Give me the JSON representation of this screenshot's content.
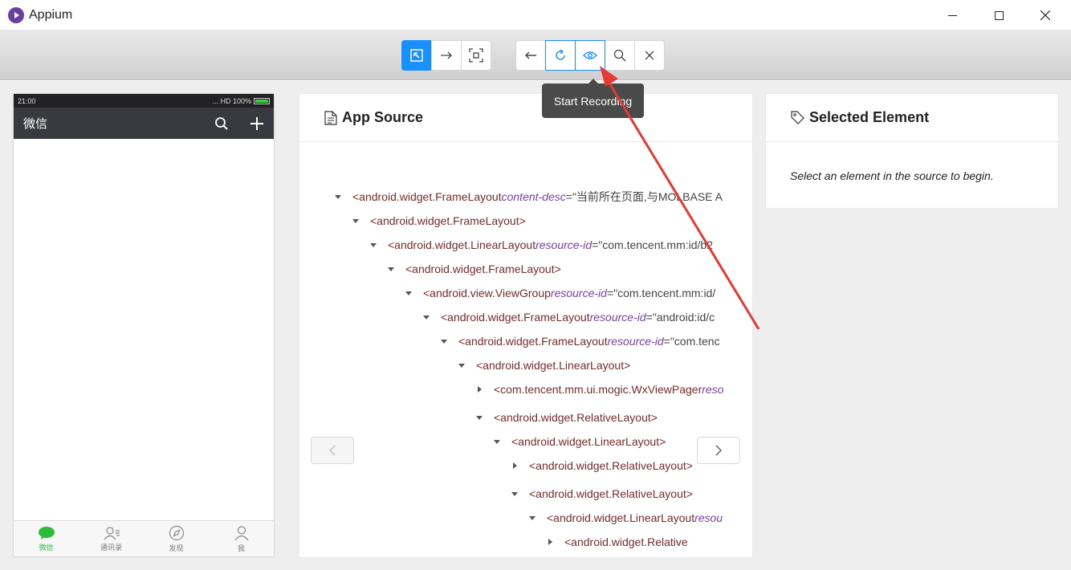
{
  "window": {
    "title": "Appium",
    "controls": [
      "minimize",
      "maximize",
      "close"
    ]
  },
  "toolbar": {
    "group1": [
      {
        "name": "select-elements",
        "icon": "select-cursor-icon",
        "active": true
      },
      {
        "name": "swipe-by-coordinates",
        "icon": "arrow-right-icon"
      },
      {
        "name": "tap-by-coordinates",
        "icon": "crosshair-icon"
      }
    ],
    "group2": [
      {
        "name": "back",
        "icon": "back-arrow-icon"
      },
      {
        "name": "refresh",
        "icon": "refresh-icon"
      },
      {
        "name": "start-recording",
        "icon": "eye-icon"
      },
      {
        "name": "search",
        "icon": "search-icon"
      },
      {
        "name": "quit-session",
        "icon": "close-icon"
      }
    ],
    "tooltip": "Start Recording"
  },
  "phone": {
    "status_time": "21:00",
    "status_right": "... HD 100%",
    "app_title": "微信",
    "tabs": [
      {
        "label": "微信",
        "icon": "chat-bubble-icon",
        "active": true
      },
      {
        "label": "通讯录",
        "icon": "contacts-icon"
      },
      {
        "label": "发现",
        "icon": "compass-icon"
      },
      {
        "label": "我",
        "icon": "person-icon"
      }
    ]
  },
  "source_panel": {
    "title": "App Source",
    "nodes": [
      {
        "caret": "down",
        "tag": "<android.widget.FrameLayout",
        "attr": "content-desc",
        "val": "=\"当前所在页面,与MOLBASE A"
      },
      {
        "caret": "down",
        "tag": "<android.widget.FrameLayout>",
        "attr": "",
        "val": ""
      },
      {
        "caret": "down",
        "tag": "<android.widget.LinearLayout",
        "attr": "resource-id",
        "val": "=\"com.tencent.mm:id/b2"
      },
      {
        "caret": "down",
        "tag": "<android.widget.FrameLayout>",
        "attr": "",
        "val": ""
      },
      {
        "caret": "down",
        "tag": "<android.view.ViewGroup",
        "attr": "resource-id",
        "val": "=\"com.tencent.mm:id/"
      },
      {
        "caret": "down",
        "tag": "<android.widget.FrameLayout",
        "attr": "resource-id",
        "val": "=\"android:id/c"
      },
      {
        "caret": "down",
        "tag": "<android.widget.FrameLayout",
        "attr": "resource-id",
        "val": "=\"com.tenc"
      },
      {
        "caret": "down",
        "tag": "<android.widget.LinearLayout>",
        "attr": "",
        "val": ""
      },
      {
        "caret": "right",
        "tag": "<com.tencent.mm.ui.mogic.WxViewPager",
        "attr": "reso",
        "val": ""
      },
      {
        "caret": "down",
        "tag": "<android.widget.RelativeLayout>",
        "attr": "",
        "val": ""
      },
      {
        "caret": "down",
        "tag": "<android.widget.LinearLayout>",
        "attr": "",
        "val": ""
      },
      {
        "caret": "right",
        "tag": "<android.widget.RelativeLayout>",
        "attr": "",
        "val": ""
      },
      {
        "caret": "down",
        "tag": "<android.widget.RelativeLayout>",
        "attr": "",
        "val": ""
      },
      {
        "caret": "down",
        "tag": "<android.widget.LinearLayout",
        "attr": "resou",
        "val": ""
      },
      {
        "caret": "right",
        "tag": "<android.widget.Relative",
        "attr": "",
        "val": ""
      }
    ]
  },
  "selected_panel": {
    "title": "Selected Element",
    "hint": "Select an element in the source to begin."
  },
  "colors": {
    "accent": "#1890ff",
    "annotation": "#e53935",
    "wechat_green": "#2dbb3a"
  }
}
